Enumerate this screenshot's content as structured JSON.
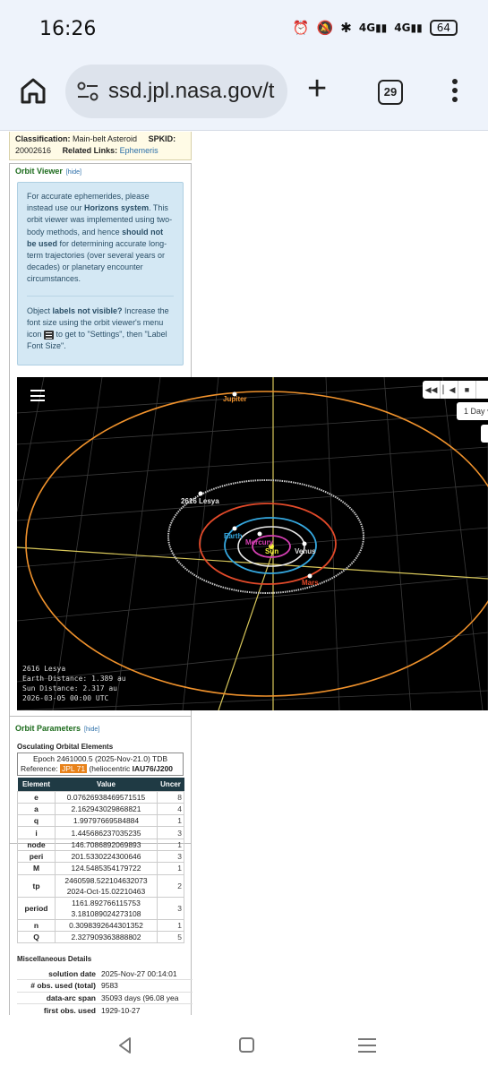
{
  "status": {
    "time": "16:26",
    "network1": "4G",
    "network2": "4G",
    "battery": "64"
  },
  "browser": {
    "url": "ssd.jpl.nasa.gov/t",
    "tab_count": "29"
  },
  "summary": {
    "classification_label": "Classification:",
    "classification_value": "Main-belt Asteroid",
    "spkid_label": "SPKID:",
    "spkid_value": "20002616",
    "related_label": "Related Links:",
    "related_value": "Ephemeris"
  },
  "orbit_viewer": {
    "title": "Orbit Viewer",
    "hide": "[hide]",
    "info_p1_a": "For accurate ephemerides, please instead use our ",
    "info_p1_b": "Horizons system",
    "info_p1_c": ". This orbit viewer was implemented using two-body methods, and hence ",
    "info_p1_d": "should not be used",
    "info_p1_e": " for determining accurate long-term trajectories (over several years or decades) or planetary encounter circumstances.",
    "info_p2_a": "Object ",
    "info_p2_b": "labels not visible?",
    "info_p2_c": " Increase the font size using the orbit viewer's menu icon ",
    "info_p2_d": " to get to \"Settings\", then \"Label Font Size\".",
    "step_select": "1 Day",
    "labels": {
      "jupiter": "Jupiter",
      "asteroid": "2616 Lesya",
      "earth": "Earth",
      "mercury": "Mercury",
      "sun": "Sun",
      "venus": "Venus",
      "mars": "Mars"
    },
    "colors": {
      "jupiter": "#f0922c",
      "asteroid": "#cccccc",
      "mars": "#e24a2a",
      "earth": "#35a8e0",
      "venus": "#e9e9e9",
      "mercury": "#d63fb4",
      "sun": "#d8e02a",
      "axis": "#d8c75a"
    },
    "readout_name": "2616 Lesya",
    "readout_earth": "Earth Distance: 1.389 au",
    "readout_sun": "Sun Distance: 2.317 au",
    "readout_date": "2026-03-05 00:00 UTC"
  },
  "orbit_params": {
    "title": "Orbit Parameters",
    "hide": "[hide]",
    "osc_title": "Osculating Orbital Elements",
    "epoch_line": "Epoch 2461000.5 (2025-Nov-21.0) TDB",
    "ref_label": "Reference: ",
    "ref_badge": "JPL 71",
    "ref_rest": " (heliocentric ",
    "ref_frame": "IAU76/J200",
    "col_element": "Element",
    "col_value": "Value",
    "col_uncert": "Uncer",
    "rows": [
      {
        "k": "e",
        "v": "0.07626938469571515",
        "u": "8"
      },
      {
        "k": "a",
        "v": "2.162943029868821",
        "u": "4"
      },
      {
        "k": "q",
        "v": "1.99797669584884",
        "u": "1"
      },
      {
        "k": "i",
        "v": "1.445686237035235",
        "u": "3"
      },
      {
        "k": "node",
        "v": "146.7086892069893",
        "u": "1"
      },
      {
        "k": "peri",
        "v": "201.5330224300646",
        "u": "3"
      },
      {
        "k": "M",
        "v": "124.5485354179722",
        "u": "1"
      },
      {
        "k": "tp",
        "v": "2460598.522104632073",
        "v2": "2024-Oct-15.02210463",
        "u": "2"
      },
      {
        "k": "period",
        "v": "1161.892766115753",
        "v2": "3.181089024273108",
        "u": "3"
      },
      {
        "k": "n",
        "v": "0.3098392644301352",
        "u": "1"
      },
      {
        "k": "Q",
        "v": "2.327909363888802",
        "u": "5"
      }
    ],
    "misc_title": "Miscellaneous Details",
    "misc_rows": [
      {
        "k": "solution date",
        "v": "2025-Nov-27 00:14:01"
      },
      {
        "k": "# obs. used (total)",
        "v": "9583"
      },
      {
        "k": "data-arc span",
        "v": "35093 days (96.08 yea"
      },
      {
        "k": "first obs. used",
        "v": "1929-10-27"
      }
    ]
  }
}
